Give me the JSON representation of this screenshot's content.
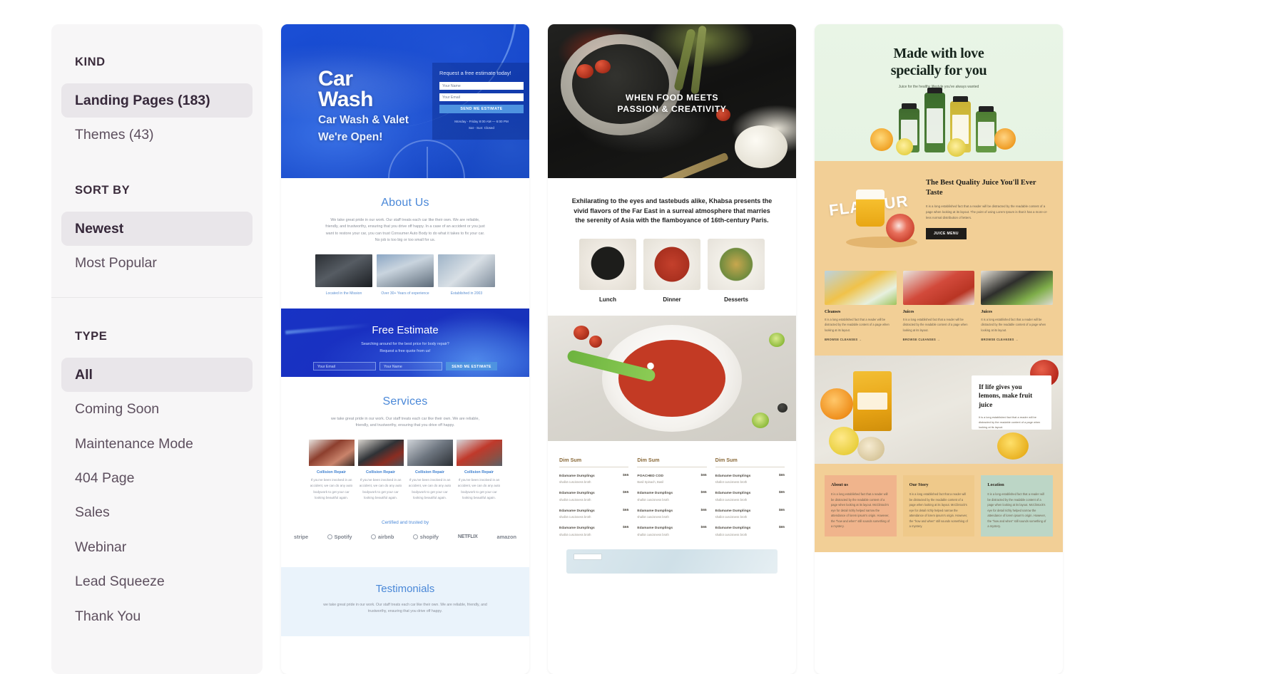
{
  "sidebar": {
    "groups": [
      {
        "title": "KIND",
        "options": [
          {
            "label": "Landing Pages (183)",
            "active": true
          },
          {
            "label": "Themes (43)",
            "active": false
          }
        ]
      },
      {
        "title": "SORT BY",
        "options": [
          {
            "label": "Newest",
            "active": true
          },
          {
            "label": "Most Popular",
            "active": false
          }
        ]
      },
      {
        "title": "TYPE",
        "options": [
          {
            "label": "All",
            "active": true
          },
          {
            "label": "Coming Soon",
            "active": false
          },
          {
            "label": "Maintenance Mode",
            "active": false
          },
          {
            "label": "404 Page",
            "active": false
          },
          {
            "label": "Sales",
            "active": false
          },
          {
            "label": "Webinar",
            "active": false
          },
          {
            "label": "Lead Squeeze",
            "active": false
          },
          {
            "label": "Thank You",
            "active": false
          }
        ]
      }
    ]
  },
  "cards": {
    "carwash": {
      "hero": {
        "title_line1": "Car",
        "title_line2": "Wash",
        "subtitle_line1": "Car Wash & Valet",
        "subtitle_line2": "We're Open!",
        "form_heading": "Request a free estimate today!",
        "input_name": "Your Name",
        "input_email": "Your Email",
        "button": "SEND ME ESTIMATE",
        "hours_line1": "Monday - Friday  8:00 AM — 6:00 PM",
        "hours_line2": "Sat - Sun: Closed"
      },
      "about": {
        "heading": "About Us",
        "body": "We take great pride in our work. Our staff treats each car like their own. We are reliable, friendly, and trustworthy, ensuring that you drive off happy. In a case of an accident or you just want to restore your car, you can trust Consumer Auto Body to do what it takes to fix your car. No job is too big or too small for us.",
        "captions": [
          "Located in the Mission",
          "Over 30+ Years of experience",
          "Established in 2003"
        ]
      },
      "estimate": {
        "heading": "Free Estimate",
        "body_line1": "Searching around for the best price for body repair?",
        "body_line2": "Request a free quote from us!",
        "input_email": "Your Email",
        "input_name": "Your Name",
        "button": "SEND ME ESTIMATE"
      },
      "services": {
        "heading": "Services",
        "body": "we take great pride in our work. Our staff treats each car like their own. We are reliable, friendly, and trustworthy, ensuring that you drive off happy.",
        "items": [
          {
            "title": "Collision Repair",
            "desc": "If you've been involved in an accident, we can do any auto bodywork to get your car looking beautiful again."
          },
          {
            "title": "Collision Repair",
            "desc": "If you've been involved in an accident, we can do any auto bodywork to get your car looking beautiful again."
          },
          {
            "title": "Collision Repair",
            "desc": "If you've been involved in an accident, we can do any auto bodywork to get your car looking beautiful again."
          },
          {
            "title": "Collision Repair",
            "desc": "If you've been involved in an accident, we can do any auto bodywork to get your car looking beautiful again."
          }
        ]
      },
      "trust": {
        "heading": "Certified and trusted by",
        "logos": [
          "stripe",
          "Spotify",
          "airbnb",
          "shopify",
          "NETFLIX",
          "amazon"
        ]
      },
      "testimonials": {
        "heading": "Testimonials",
        "body": "we take great pride in our work. Our staff treats each car like their own. We are reliable, friendly, and trustworthy, ensuring that you drive off happy."
      }
    },
    "food": {
      "hero_line1": "WHEN FOOD MEETS",
      "hero_line2": "PASSION & CREATIVITY",
      "intro": "Exhilarating to the eyes and tastebuds alike, Khabsa presents the vivid flavors of the Far East in a surreal atmosphere that marries the serenity of Asia with the flamboyance of 16th-century Paris.",
      "dishes": [
        "Lunch",
        "Dinner",
        "Desserts"
      ],
      "menu_columns": [
        {
          "heading": "Dim Sum",
          "items": [
            {
              "name": "Edamame Dumplings",
              "desc": "shallot cuscisness broth",
              "price": "$65"
            },
            {
              "name": "Edamame Dumplings",
              "desc": "shallot cuscisness broth",
              "price": "$65"
            },
            {
              "name": "Edamame Dumplings",
              "desc": "shallot cuscisness broth",
              "price": "$65"
            },
            {
              "name": "Edamame Dumplings",
              "desc": "shallot cuscisness broth",
              "price": "$65"
            }
          ]
        },
        {
          "heading": "Dim Sum",
          "items": [
            {
              "name": "POACHED COD",
              "desc": "Basil Spinach, Basil",
              "price": "$65"
            },
            {
              "name": "Edamame Dumplings",
              "desc": "shallot cuscisness broth",
              "price": "$65"
            },
            {
              "name": "Edamame Dumplings",
              "desc": "shallot cuscisness broth",
              "price": "$65"
            },
            {
              "name": "Edamame Dumplings",
              "desc": "shallot cuscisness broth",
              "price": "$65"
            }
          ]
        },
        {
          "heading": "Dim Sum",
          "items": [
            {
              "name": "Edamame Dumplings",
              "desc": "shallot cuscisness broth",
              "price": "$65"
            },
            {
              "name": "Edamame Dumplings",
              "desc": "shallot cuscisness broth",
              "price": "$65"
            },
            {
              "name": "Edamame Dumplings",
              "desc": "shallot cuscisness broth",
              "price": "$65"
            },
            {
              "name": "Edamame Dumplings",
              "desc": "shallot cuscisness broth",
              "price": "$65"
            }
          ]
        }
      ]
    },
    "juice": {
      "hero_line1": "Made with love",
      "hero_line2": "specially for you",
      "hero_sub": "Juice for the healthy lifestyle you've always wanted",
      "flavour_word": "FLAVOUR",
      "promo_heading": "The Best Quality Juice You'll Ever Taste",
      "promo_body": "It is a long established fact that a reader will be distracted by the readable content of a page when looking at its layout. The point of using Lorem Ipsum is that it has a more-or-less normal distribution of letters.",
      "promo_button": "JUICE MENU",
      "cards": [
        {
          "title": "Cleanses",
          "desc": "It is a long established fact that a reader will be distracted by the readable content of a page when looking at its layout.",
          "link": "BROWSE CLEANSES →"
        },
        {
          "title": "Juices",
          "desc": "It is a long established fact that a reader will be distracted by the readable content of a page when looking at its layout.",
          "link": "BROWSE CLEANSES →"
        },
        {
          "title": "Juices",
          "desc": "It is a long established fact that a reader will be distracted by the readable content of a page when looking at its layout.",
          "link": "BROWSE CLEANSES →"
        }
      ],
      "quote": "If life gives you lemons, make fruit juice",
      "quote_body": "It is a long established fact that a reader will be distracted by the readable content of a page when looking at its layout.",
      "bottom_cards": [
        {
          "title": "About us",
          "desc": "It is a long established fact that a reader will be distracted by the readable content of a page when looking at its layout. McClintock's eye for detail richly helped narrow the attendance of lorem ipsum's origin. However, the \"how and when\" still sounds something of a mystery."
        },
        {
          "title": "Our Story",
          "desc": "It is a long established fact that a reader will be distracted by the readable content of a page when looking at its layout. McClintock's eye for detail richly helped narrow the attendance of lorem ipsum's origin. However, the \"how and when\" still sounds something of a mystery."
        },
        {
          "title": "Location",
          "desc": "It is a long established fact that a reader will be distracted by the readable content of a page when looking at its layout. McClintock's eye for detail richly helped narrow the attendance of lorem ipsum's origin. However, the \"how and when\" still sounds something of a mystery."
        }
      ]
    }
  }
}
